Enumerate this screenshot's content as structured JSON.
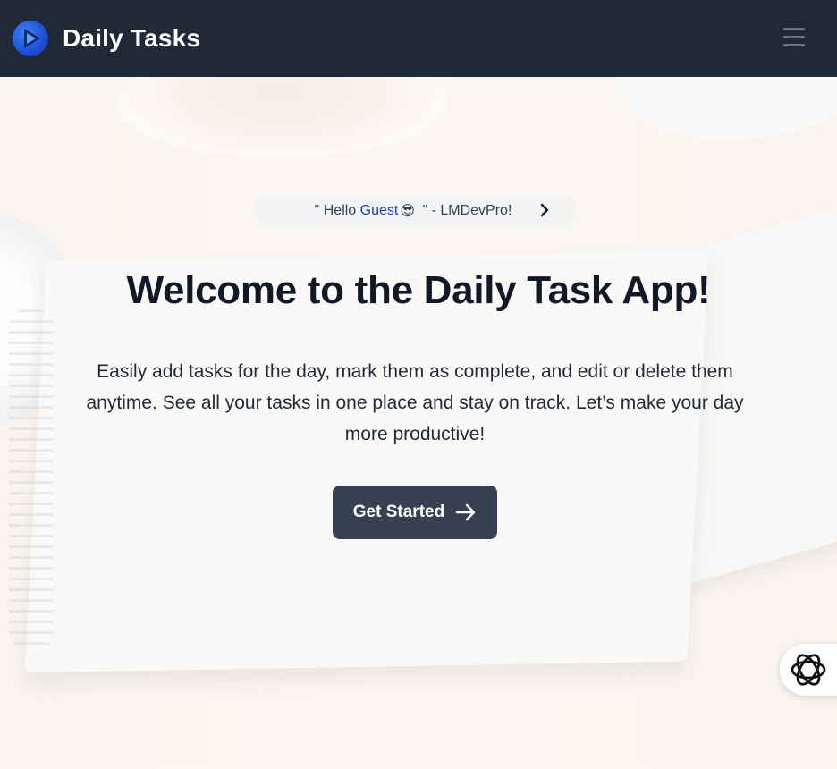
{
  "navbar": {
    "brand": "Daily Tasks",
    "logo_icon": "play-logo-icon",
    "menu_icon": "hamburger-menu-icon"
  },
  "announcement": {
    "prefix": "\" Hello ",
    "guest": "Guest",
    "emoji": "😎",
    "suffix": " \" - LMDevPro!",
    "chevron_icon": "chevron-right-icon"
  },
  "hero": {
    "title": "Welcome to the Daily Task App!",
    "description": "Easily add tasks for the day, mark them as complete, and edit or delete them anytime. See all your tasks in one place and stay on track. Let’s make your day more productive!",
    "cta_label": "Get Started",
    "cta_icon": "arrow-right-icon"
  },
  "widget": {
    "icon": "assistant-knot-icon"
  },
  "colors": {
    "navbar_bg": "#1f2937",
    "cta_bg": "#374151",
    "accent": "#1e40af"
  }
}
